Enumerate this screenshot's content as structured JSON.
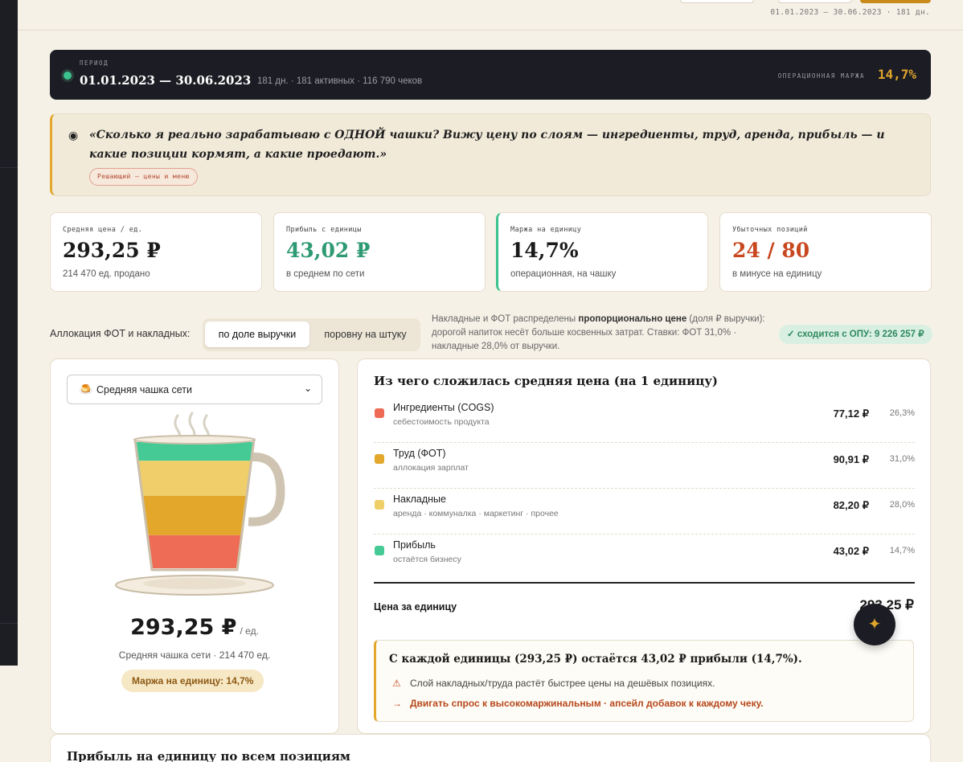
{
  "header": {
    "period_range": "01.01.2023 — 30.06.2023 · 181 дн."
  },
  "period_bar": {
    "label": "ПЕРИОД",
    "dates": "01.01.2023 — 30.06.2023",
    "meta": "181 дн. · 181 активных · 116 790 чеков",
    "margin_label": "ОПЕРАЦИОННАЯ МАРЖА",
    "margin_value": "14,7%"
  },
  "quote": {
    "bullet": "◉",
    "text": "«Сколько я реально зарабатываю с ОДНОЙ чашки? Вижу цену по слоям — ингредиенты, труд, аренда, прибыль — и какие позиции кормят, а какие проедают.»",
    "tag": "Решающий — цены и меню"
  },
  "kpis": [
    {
      "label": "Средняя цена / ед.",
      "value": "293,25 ₽",
      "sub": "214 470 ед. продано"
    },
    {
      "label": "Прибыль с единицы",
      "value": "43,02 ₽",
      "sub": "в среднем по сети"
    },
    {
      "label": "Маржа на единицу",
      "value": "14,7%",
      "sub": "операционная, на чашку"
    },
    {
      "label": "Убыточных позиций",
      "value": "24 / 80",
      "sub": "в минусе на единицу"
    }
  ],
  "allocation": {
    "label": "Аллокация ФОТ и накладных:",
    "options": [
      "по доле выручки",
      "поровну на штуку"
    ],
    "note_pre": "Накладные и ФОТ распределены ",
    "note_bold": "пропорционально цене",
    "note_post": " (доля ₽ выручки): дорогой напиток несёт больше косвенных затрат. Ставки: ФОТ 31,0% · накладные 28,0% от выручки.",
    "check": "✓ сходится с ОПУ: 9 226 257 ₽"
  },
  "cup_card": {
    "select_icon": "🍮",
    "select_value": "Средняя чашка сети",
    "select_chevron": "⌄",
    "price": "293,25 ₽",
    "unit": "/ ед.",
    "caption": "Средняя чашка сети · 214 470 ед.",
    "margin_pill": "Маржа на единицу: 14,7%",
    "layers": [
      {
        "name": "Ингредиенты (COGS)",
        "share": 26.3,
        "color": "#ee6b55"
      },
      {
        "name": "Труд (ФОТ)",
        "share": 31.0,
        "color": "#e2a72b"
      },
      {
        "name": "Накладные",
        "share": 28.0,
        "color": "#f0cf6a"
      },
      {
        "name": "Прибыль",
        "share": 14.7,
        "color": "#45c995"
      }
    ]
  },
  "breakdown": {
    "title": "Из чего сложилась средняя цена (на 1 единицу)",
    "rows": [
      {
        "name": "Ингредиенты (COGS)",
        "sub": "себестоимость продукта",
        "value": "77,12 ₽",
        "pct": "26,3%",
        "color": "#ee6b55"
      },
      {
        "name": "Труд (ФОТ)",
        "sub": "аллокация зарплат",
        "value": "90,91 ₽",
        "pct": "31,0%",
        "color": "#e2a72b"
      },
      {
        "name": "Накладные",
        "sub": "аренда · коммуналка · маркетинг · прочее",
        "value": "82,20 ₽",
        "pct": "28,0%",
        "color": "#f0cf6a"
      },
      {
        "name": "Прибыль",
        "sub": "остаётся бизнесу",
        "value": "43,02 ₽",
        "pct": "14,7%",
        "color": "#45c995"
      }
    ],
    "total_label": "Цена за единицу",
    "total_value": "293,25 ₽",
    "insight_title": "С каждой единицы (293,25 ₽) остаётся 43,02 ₽ прибыли (14,7%).",
    "warn_icon": "⚠",
    "warn_text": "Слой накладных/труда растёт быстрее цены на дешёвых позициях.",
    "arrow_icon": "→",
    "arrow_text": "Двигать спрос к высокомаржинальным · апсейл добавок к каждому чеку."
  },
  "fab_icon": "✦",
  "bottom": {
    "title": "Прибыль на единицу по всем позициям"
  }
}
